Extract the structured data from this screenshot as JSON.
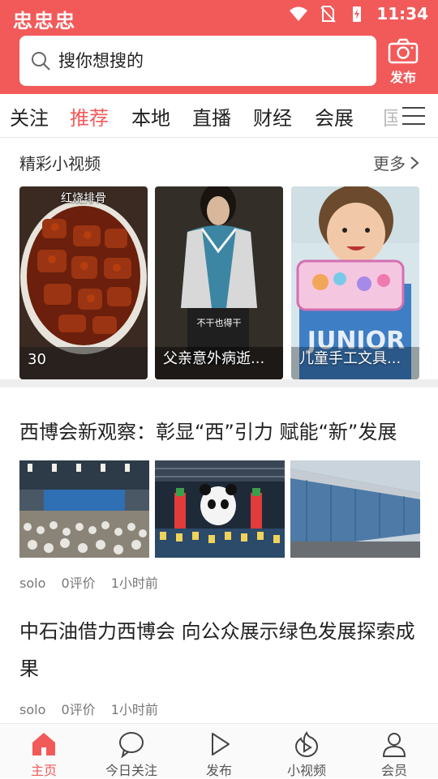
{
  "status_bar": {
    "app_icons": "忠忠忠",
    "time": "11:34"
  },
  "search": {
    "placeholder": "搜你想搜的"
  },
  "header": {
    "publish_label": "发布"
  },
  "tabs": [
    {
      "label": "关注",
      "active": false
    },
    {
      "label": "推荐",
      "active": true
    },
    {
      "label": "本地",
      "active": false
    },
    {
      "label": "直播",
      "active": false
    },
    {
      "label": "财经",
      "active": false
    },
    {
      "label": "会展",
      "active": false
    }
  ],
  "tab_partial": "国",
  "videos": {
    "title": "精彩小视频",
    "more_label": "更多",
    "items": [
      {
        "caption": "30",
        "overlay_text": "红烧排骨",
        "icon": "braised-pork-thumbnail"
      },
      {
        "caption": "父亲意外病逝...",
        "overlay_text": "不干也得干",
        "icon": "girl-jacket-thumbnail"
      },
      {
        "caption": "儿童手工文具...",
        "overlay_text": "",
        "icon": "child-pencil-case-thumbnail"
      }
    ]
  },
  "articles": [
    {
      "title": "西博会新观察：彰显“西”引力 赋能“新”发展",
      "images": [
        "conference-hall-photo",
        "panda-display-photo",
        "expo-building-photo"
      ],
      "author": "solo",
      "comments": "0评价",
      "time": "1小时前"
    },
    {
      "title": "中石油借力西博会 向公众展示绿色发展探索成果",
      "author": "solo",
      "comments": "0评价",
      "time": "1小时前"
    }
  ],
  "bottom_nav": [
    {
      "label": "主页",
      "icon": "home-icon",
      "active": true
    },
    {
      "label": "今日关注",
      "icon": "chat-bubble-icon",
      "active": false
    },
    {
      "label": "发布",
      "icon": "play-triangle-icon",
      "active": false
    },
    {
      "label": "小视频",
      "icon": "video-flame-icon",
      "active": false
    },
    {
      "label": "会员",
      "icon": "user-icon",
      "active": false
    }
  ],
  "colors": {
    "brand_red": "#f25a5a",
    "text_dark": "#222222",
    "text_gray": "#777777"
  }
}
